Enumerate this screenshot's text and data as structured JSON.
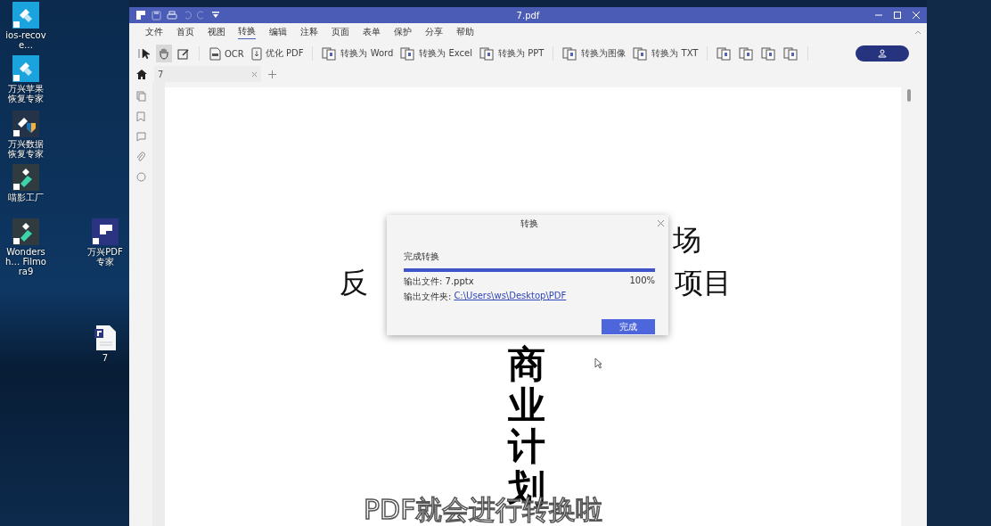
{
  "desktop_icons": [
    {
      "label": "ios-recove…",
      "kind": "recover-tile"
    },
    {
      "label": "万兴苹果恢复专家",
      "kind": "recover-tile"
    },
    {
      "label": "万兴数据恢复专家",
      "kind": "data-tile"
    },
    {
      "label": "喵影工厂",
      "kind": "film-tile"
    },
    {
      "label": "Wondersh… Filmora9",
      "kind": "film-tile"
    },
    {
      "label": "万兴PDF专家",
      "kind": "pdf-tile"
    },
    {
      "label": "7",
      "kind": "file"
    }
  ],
  "window": {
    "title": "7.pdf"
  },
  "menu": [
    {
      "label": "文件",
      "selected": false
    },
    {
      "label": "首页",
      "selected": false
    },
    {
      "label": "视图",
      "selected": false
    },
    {
      "label": "转换",
      "selected": true
    },
    {
      "label": "编辑",
      "selected": false
    },
    {
      "label": "注释",
      "selected": false
    },
    {
      "label": "页面",
      "selected": false
    },
    {
      "label": "表单",
      "selected": false
    },
    {
      "label": "保护",
      "selected": false
    },
    {
      "label": "分享",
      "selected": false
    },
    {
      "label": "帮助",
      "selected": false
    }
  ],
  "tools": [
    {
      "kind": "pointer",
      "selected": false
    },
    {
      "kind": "hand",
      "selected": true
    },
    {
      "kind": "edit",
      "selected": false
    }
  ],
  "toolbar_groups": [
    [
      {
        "kind": "ocr",
        "label": "OCR"
      },
      {
        "kind": "optimize",
        "label": "优化 PDF"
      }
    ],
    [
      {
        "kind": "doc",
        "label": "转换为 Word"
      },
      {
        "kind": "doc",
        "label": "转换为 Excel"
      },
      {
        "kind": "doc",
        "label": "转换为 PPT"
      }
    ],
    [
      {
        "kind": "doc",
        "label": "转换为图像"
      },
      {
        "kind": "doc",
        "label": "转换为 TXT"
      }
    ],
    [
      {
        "kind": "doc"
      },
      {
        "kind": "doc"
      },
      {
        "kind": "doc"
      },
      {
        "kind": "doc"
      }
    ]
  ],
  "doc_tabs": [
    {
      "label": "7"
    }
  ],
  "document": {
    "line_1_right": "场",
    "line_2_left": "反",
    "line_2_right": "项目",
    "vertical_title": "商业计划"
  },
  "dialog": {
    "title": "转换",
    "status": "完成转换",
    "progress": {
      "level": 1,
      "percent": "100%"
    },
    "output_file": "输出文件: 7.pptx",
    "folder_label": "输出文件夹:",
    "folder_link": "C:\\Users\\ws\\Desktop\\PDF",
    "button": "完成"
  },
  "caption": "PDF就会进行转换啦"
}
